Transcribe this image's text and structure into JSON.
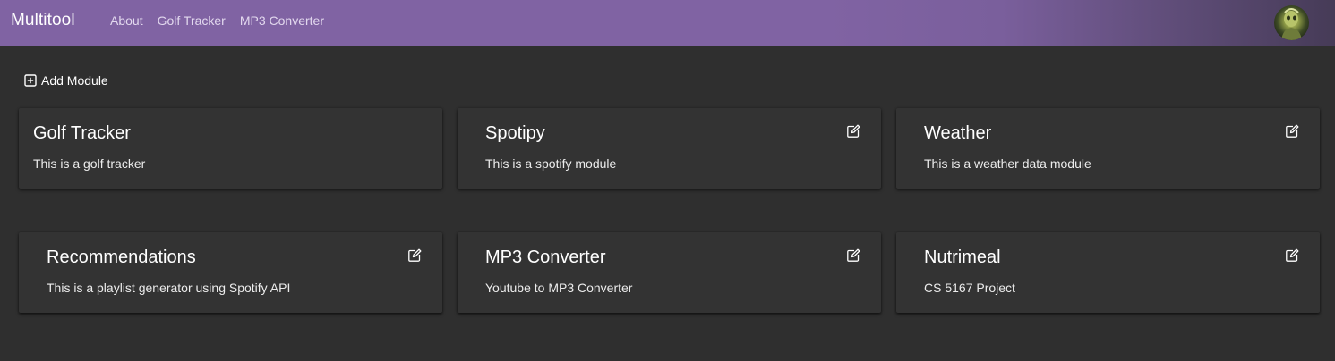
{
  "navbar": {
    "brand": "Multitool",
    "links": [
      {
        "label": "About"
      },
      {
        "label": "Golf Tracker"
      },
      {
        "label": "MP3 Converter"
      }
    ],
    "avatar_icon": "user-avatar"
  },
  "toolbar": {
    "add_module_label": "Add Module",
    "add_icon": "plus-square-icon"
  },
  "modules": [
    {
      "title": "Golf Tracker",
      "description": "This is a golf tracker",
      "editable": false
    },
    {
      "title": "Spotipy",
      "description": "This is a spotify module",
      "editable": true
    },
    {
      "title": "Weather",
      "description": "This is a weather data module",
      "editable": true
    },
    {
      "title": "Recommendations",
      "description": "This is a playlist generator using Spotify API",
      "editable": true
    },
    {
      "title": "MP3 Converter",
      "description": "Youtube to MP3 Converter",
      "editable": true
    },
    {
      "title": "Nutrimeal",
      "description": "CS 5167 Project",
      "editable": true
    }
  ],
  "colors": {
    "navbar": "#8063a3",
    "background": "#2f2f2f",
    "card": "#333333"
  }
}
